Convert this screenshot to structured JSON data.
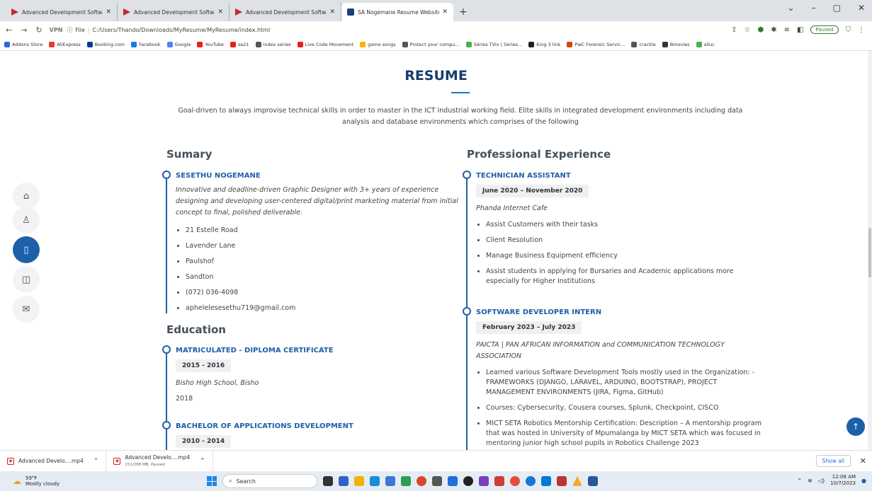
{
  "browser": {
    "tabs": [
      {
        "title": "Advanced Development Softwa",
        "icon": "play-icon",
        "active": false
      },
      {
        "title": "Advanced Development Softwa",
        "icon": "play-icon",
        "active": false
      },
      {
        "title": "Advanced Development Softwa",
        "icon": "play-icon",
        "active": false
      },
      {
        "title": "SA Nogemane Resume Website",
        "icon": "bootstrap-icon",
        "active": true
      }
    ],
    "new_tab": "+",
    "url_prefix": "File",
    "url": "C:/Users/Thando/Downloads/MyResume/MyResume/index.html",
    "vpn_label": "VPN",
    "paused_label": "Paused",
    "bookmarks": [
      {
        "label": "Addons Store",
        "color": "#2a6bd1"
      },
      {
        "label": "AliExpress",
        "color": "#e53935"
      },
      {
        "label": "Booking.com",
        "color": "#0d3b8c"
      },
      {
        "label": "Facebook",
        "color": "#1877f2"
      },
      {
        "label": "Google",
        "color": "#4285f4"
      },
      {
        "label": "YouTube",
        "color": "#e62117"
      },
      {
        "label": "se21",
        "color": "#e62117"
      },
      {
        "label": "index series",
        "color": "#555555"
      },
      {
        "label": "Live Code Movement",
        "color": "#e62117"
      },
      {
        "label": "game songs",
        "color": "#f4b400"
      },
      {
        "label": "Protect your compu...",
        "color": "#555555"
      },
      {
        "label": "Séries TVix | Séries...",
        "color": "#4caf50"
      },
      {
        "label": "King 3 link",
        "color": "#222222"
      },
      {
        "label": "PwC Forensic Servic...",
        "color": "#d04a02"
      },
      {
        "label": "crackle",
        "color": "#555555"
      },
      {
        "label": "Bmovies",
        "color": "#333333"
      },
      {
        "label": "alluc",
        "color": "#4caf50"
      }
    ]
  },
  "page": {
    "title": "RESUME",
    "intro": "Goal-driven to always improvise technical skills in order to master in the ICT industrial working field. Elite skills in integrated development environments including data analysis and database environments which comprises of the following",
    "summary": {
      "heading": "Sumary",
      "name": "SESETHU NOGEMANE",
      "description": "Innovative and deadline-driven Graphic Designer with 3+ years of experience designing and developing user-centered digital/print marketing material from initial concept to final, polished deliverable.",
      "details": [
        "21 Estelle Road",
        "Lavender Lane",
        "Paulshof",
        "Sandton",
        "(072) 036-4098",
        "aphelelesesethu719@gmail.com"
      ]
    },
    "education": {
      "heading": "Education",
      "items": [
        {
          "title": "MATRICULATED - DIPLOMA CERTIFICATE",
          "date": "2015 - 2016",
          "place": "Bisho High School, Bisho",
          "year": "2018"
        },
        {
          "title": "BACHELOR OF APPLICATIONS DEVELOPMENT",
          "date": "2010 - 2014"
        }
      ]
    },
    "experience": {
      "heading": "Professional Experience",
      "items": [
        {
          "title": "TECHNICIAN ASSISTANT",
          "date": "June 2020 – November 2020",
          "place": "Phanda Internet Cafe",
          "bullets": [
            "Assist Customers with their tasks",
            "Client Resolution",
            "Manage Business Equipment efficiency",
            "Assist students in applying for Bursaries and Academic applications more especially for Higher Institutions"
          ]
        },
        {
          "title": "SOFTWARE DEVELOPER INTERN",
          "date": "February 2023 – July 2023",
          "place": "PAICTA | PAN AFRICAN INFORMATION and COMMUNICATION TECHNOLOGY ASSOCIATION",
          "bullets": [
            "Learned various Software Development Tools mostly used in the Organization: - FRAMEWORKS (DJANGO, LARAVEL, ARDUINO, BOOTSTRAP), PROJECT MANAGEMENT ENVIRONMENTS (JIRA, Figma, GitHub)",
            "Courses: Cybersecurity, Cousera courses, Splunk, Checkpoint, CISCO",
            "MICT SETA Robotics Mentorship Certification: Description – A mentorship program that was hosted in University of Mpumalanga by MICT SETA which was focused in mentoring junior high school pupils in Robotics Challenge 2023"
          ]
        }
      ]
    },
    "side_nav": [
      {
        "icon": "home-icon",
        "glyph": "⌂",
        "active": false
      },
      {
        "icon": "person-icon",
        "glyph": "♙",
        "active": false
      },
      {
        "icon": "file-icon",
        "glyph": "▯",
        "active": true
      },
      {
        "icon": "book-icon",
        "glyph": "◫",
        "active": false
      },
      {
        "icon": "envelope-icon",
        "glyph": "✉",
        "active": false
      }
    ]
  },
  "downloads": {
    "items": [
      {
        "name": "Advanced Develo....mp4",
        "status": ""
      },
      {
        "name": "Advanced Develo....mp4",
        "status": "151/288 MB, Paused"
      }
    ],
    "show_all": "Show all"
  },
  "taskbar": {
    "temp": "59°F",
    "weather": "Mostly cloudy",
    "search_placeholder": "Search",
    "time": "12:08 AM",
    "date": "10/7/2023"
  }
}
